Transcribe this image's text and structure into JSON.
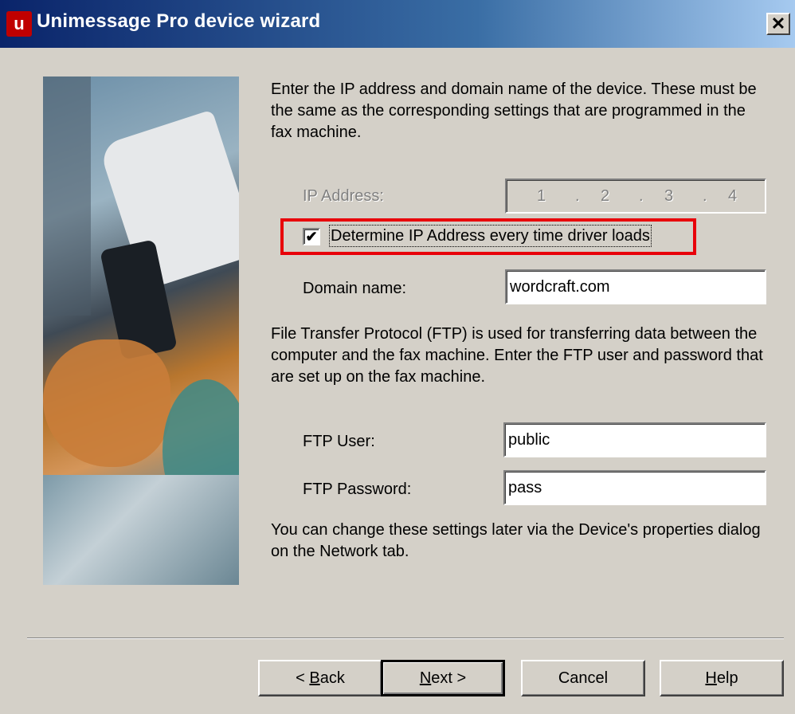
{
  "window": {
    "title": "Unimessage Pro device wizard",
    "close_glyph": "✕",
    "icon": "app-u-icon",
    "close_icon": "close-icon"
  },
  "intro_text": "Enter the IP address and domain name of the device.  These must be the same as the corresponding settings that are programmed in the fax machine.",
  "ip": {
    "label": "IP Address:",
    "octets": [
      "1",
      "2",
      "3",
      "4"
    ],
    "separator": ".",
    "disabled": true
  },
  "determine_ip": {
    "label": "Determine IP Address every time driver loads",
    "checked": true,
    "check_glyph": "✔",
    "highlight_color": "#e8000a"
  },
  "domain": {
    "label": "Domain name:",
    "value": "wordcraft.com"
  },
  "ftp_text": "File Transfer Protocol (FTP) is used for transferring data between the computer and the fax machine.  Enter the FTP user and password that are set up on the fax machine.",
  "ftp_user": {
    "label": "FTP User:",
    "value": "public"
  },
  "ftp_password": {
    "label": "FTP Password:",
    "value": "pass"
  },
  "footer_text": "You can change these settings later via the Device's properties dialog on the Network tab.",
  "buttons": {
    "back": {
      "prefix": "< ",
      "mnemonic": "B",
      "rest": "ack"
    },
    "next": {
      "mnemonic": "N",
      "rest": "ext >"
    },
    "cancel": {
      "label": "Cancel"
    },
    "help": {
      "mnemonic": "H",
      "rest": "elp"
    }
  },
  "colors": {
    "titlebar_start": "#0a246a",
    "titlebar_end": "#a6caf0",
    "dialog_bg": "#d4d0c8"
  }
}
